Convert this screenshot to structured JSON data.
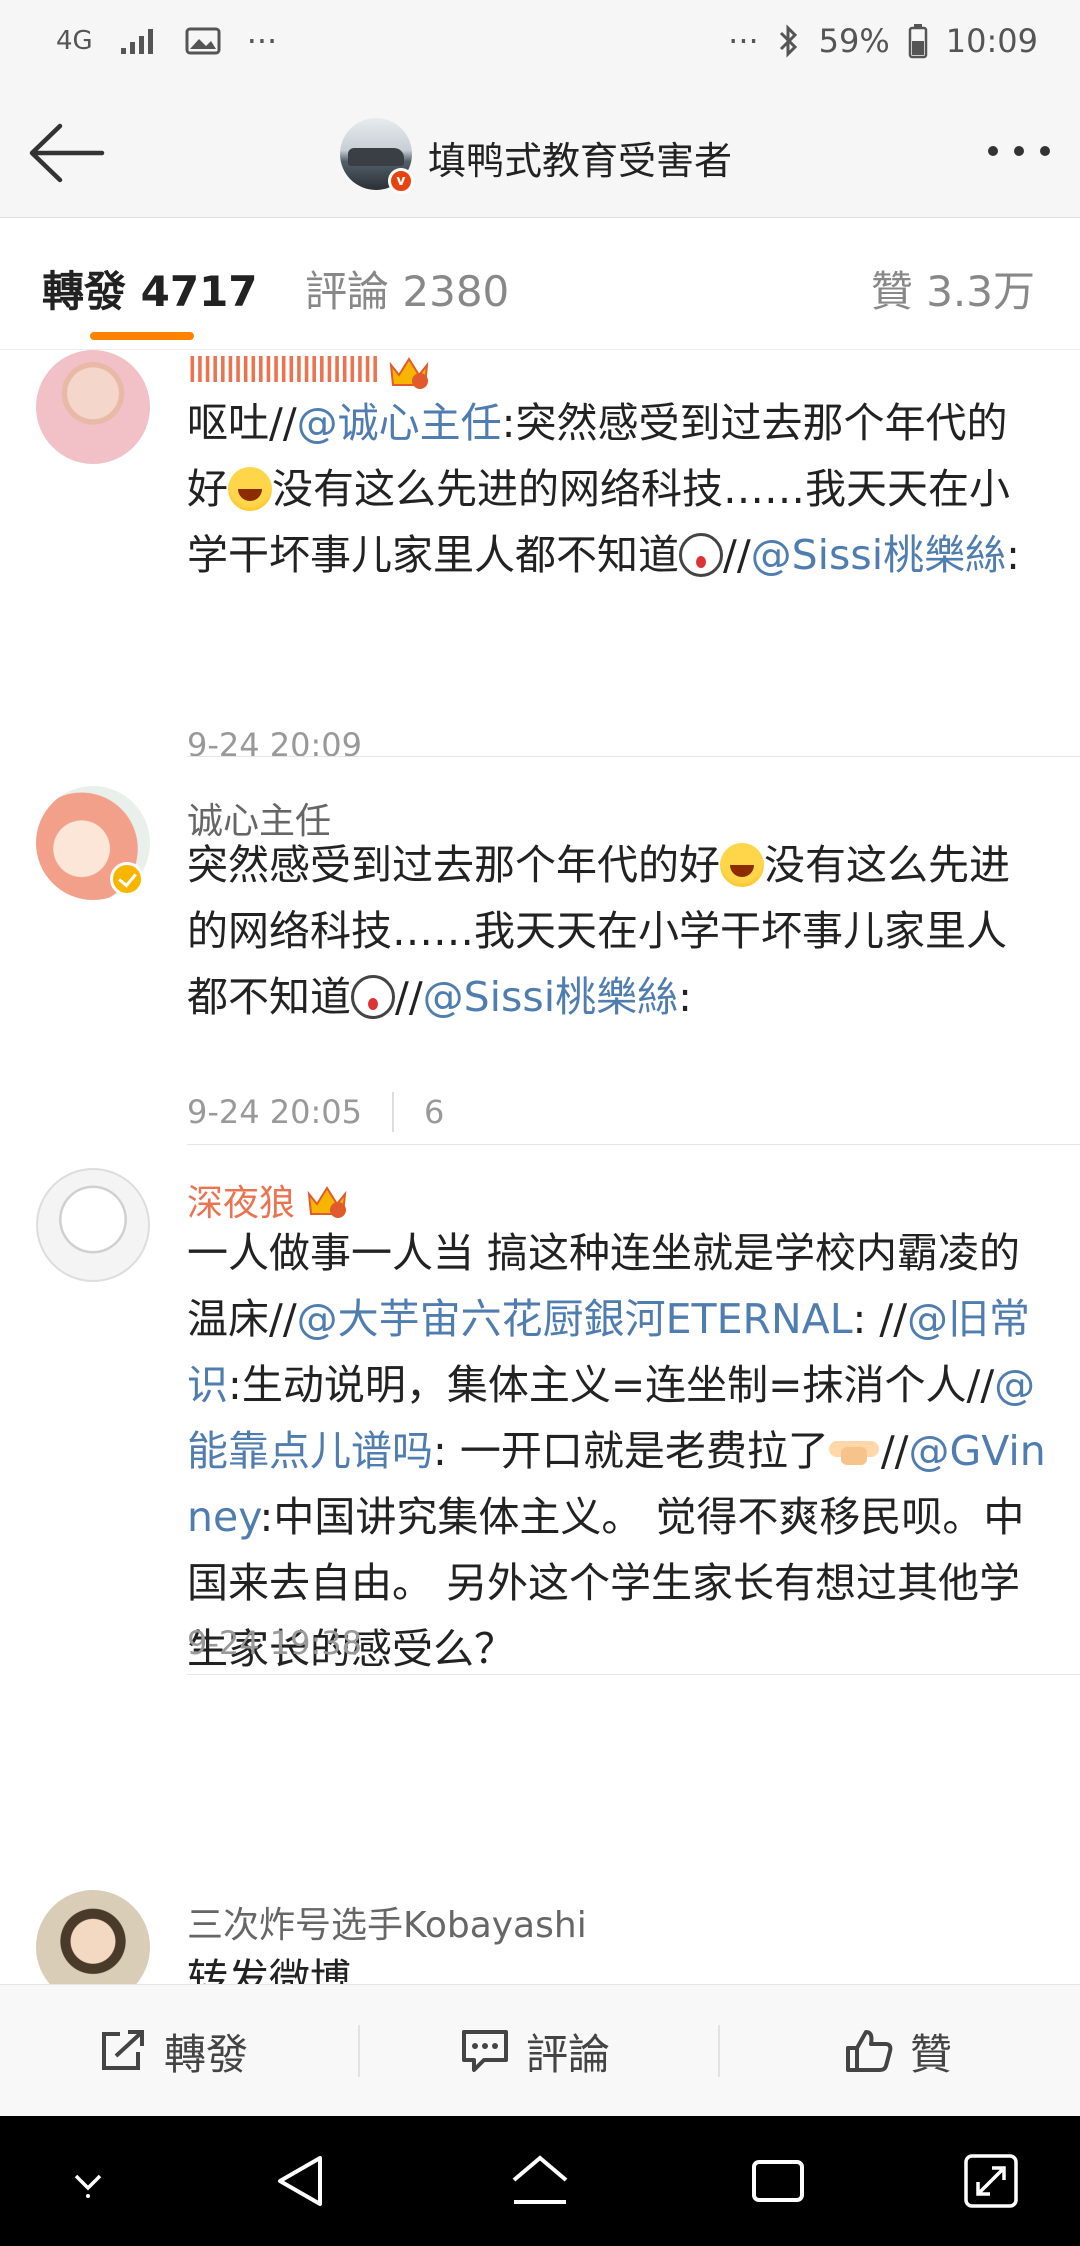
{
  "status_bar": {
    "network": "4G",
    "battery": "59%",
    "time": "10:09",
    "more": "···"
  },
  "header": {
    "title": "填鸭式教育受害者",
    "verified_mark": "v"
  },
  "tabs": {
    "repost": {
      "label": "轉發",
      "count": "4717"
    },
    "comment": {
      "label": "評論",
      "count": "2380"
    },
    "like": {
      "label": "贊",
      "count": "3.3万"
    }
  },
  "reposts": [
    {
      "username": "IIIIIIIIIIIIIIIIIIIIIIIII",
      "segments": [
        {
          "t": "呕吐//"
        },
        {
          "t": "@诚心主任",
          "mention": true
        },
        {
          "t": ":突然感受到过去那个年代的好"
        },
        {
          "emoji": "laugh"
        },
        {
          "t": "没有这么先进的网络科技……我天天在小学干坏事儿家里人都不知道"
        },
        {
          "emoji": "shock"
        },
        {
          "t": "//"
        },
        {
          "t": "@Sissi桃樂絲",
          "mention": true
        },
        {
          "t": ":"
        }
      ],
      "time": "9-24 20:09"
    },
    {
      "username": "诚心主任",
      "segments": [
        {
          "t": "突然感受到过去那个年代的好"
        },
        {
          "emoji": "laugh"
        },
        {
          "t": "没有这么先进的网络科技……我天天在小学干坏事儿家里人都不知道"
        },
        {
          "emoji": "shock"
        },
        {
          "t": "//"
        },
        {
          "t": "@Sissi桃樂絲",
          "mention": true
        },
        {
          "t": ":"
        }
      ],
      "time": "9-24 20:05",
      "likes": "6"
    },
    {
      "username": "深夜狼",
      "segments": [
        {
          "t": "一人做事一人当 搞这种连坐就是学校内霸凌的温床//"
        },
        {
          "t": "@大芋宙六花厨銀河ETERNAL",
          "mention": true
        },
        {
          "t": ": //"
        },
        {
          "t": "@旧常识",
          "mention": true
        },
        {
          "t": ":生动说明，集体主义=连坐制=抹消个人//"
        },
        {
          "t": "@能靠点儿谱吗",
          "mention": true
        },
        {
          "t": ": 一开口就是老费拉了"
        },
        {
          "emoji": "point"
        },
        {
          "t": "//"
        },
        {
          "t": "@GVinney",
          "mention": true
        },
        {
          "t": ":中国讲究集体主义。 觉得不爽移民呗。中国来去自由。 另外这个学生家长有想过其他学生家长的感受么？"
        }
      ],
      "time": "9-24 19:38"
    },
    {
      "username": "三次炸号选手Kobayashi",
      "segments": [
        {
          "t": "转发微博"
        }
      ]
    }
  ],
  "action_bar": {
    "repost": "轉發",
    "comment": "評論",
    "like": "贊"
  },
  "colors": {
    "accent": "#ff8200",
    "mention": "#507daf",
    "vip_name": "#eb7350"
  }
}
